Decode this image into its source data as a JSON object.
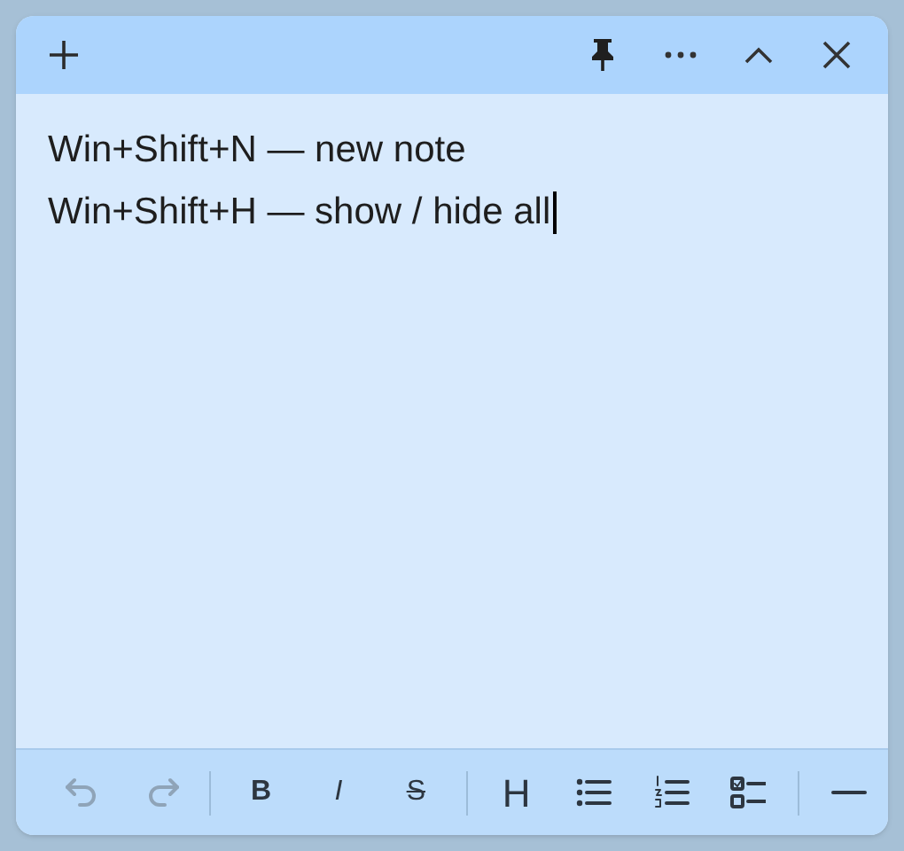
{
  "note": {
    "lines": [
      "Win+Shift+N — new note",
      "Win+Shift+H — show / hide all"
    ]
  },
  "toolbar": {
    "groups": [
      {
        "buttons": [
          {
            "kind": "undo",
            "disabled": true
          },
          {
            "kind": "redo",
            "disabled": true
          }
        ]
      },
      {
        "buttons": [
          {
            "kind": "bold",
            "label": "B",
            "disabled": false
          },
          {
            "kind": "italic",
            "label": "I",
            "disabled": false
          },
          {
            "kind": "strike",
            "label": "S",
            "disabled": false
          }
        ]
      },
      {
        "buttons": [
          {
            "kind": "heading",
            "label": "H",
            "disabled": false
          },
          {
            "kind": "bullets",
            "disabled": false
          },
          {
            "kind": "numbers",
            "disabled": false
          },
          {
            "kind": "checklist",
            "disabled": false
          }
        ]
      },
      {
        "buttons": [
          {
            "kind": "rule",
            "disabled": false
          }
        ]
      }
    ]
  }
}
